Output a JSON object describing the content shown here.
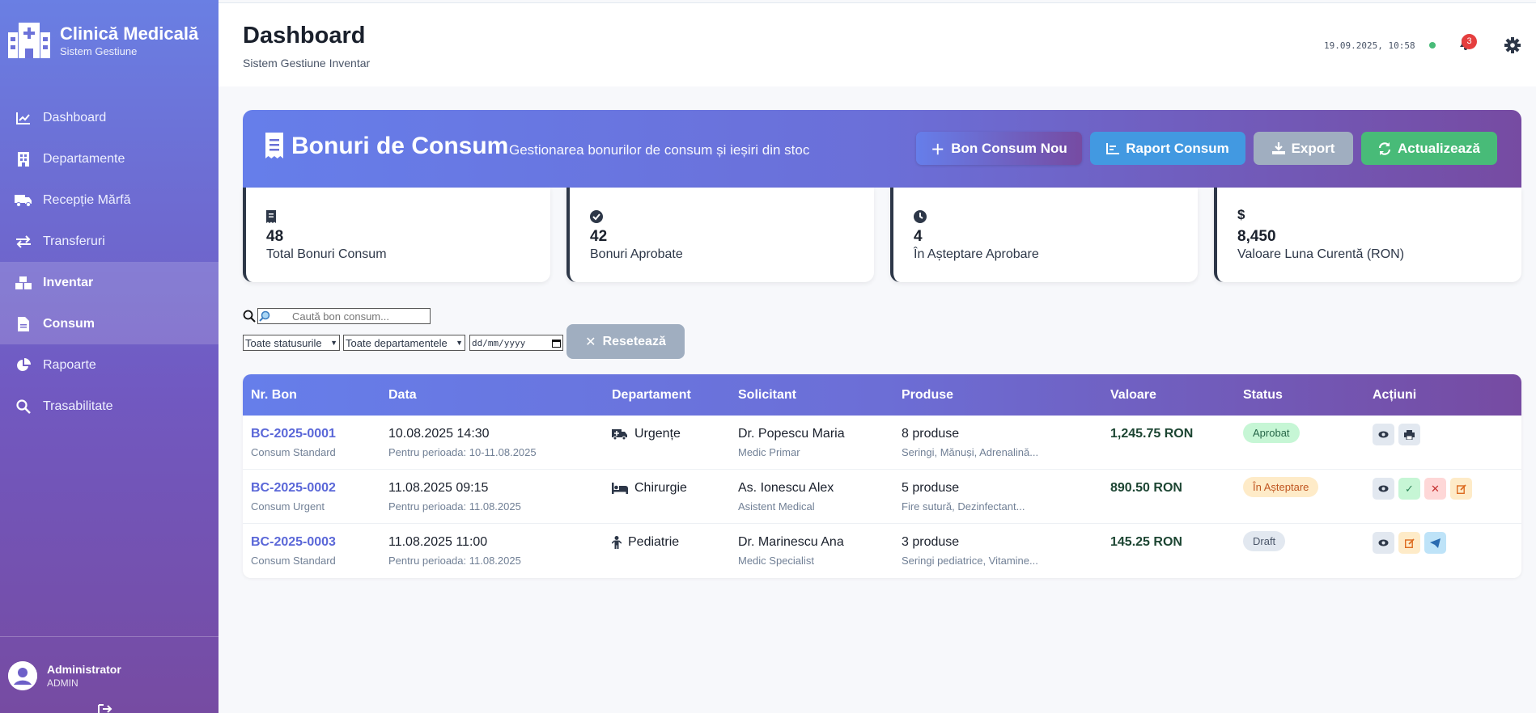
{
  "sidebar": {
    "brand_title": "Clinică Medicală",
    "brand_sub": "Sistem Gestiune",
    "items": [
      {
        "label": "Dashboard",
        "icon": "chart-line-icon"
      },
      {
        "label": "Departamente",
        "icon": "building-icon"
      },
      {
        "label": "Recepție Mărfă",
        "icon": "truck-icon"
      },
      {
        "label": "Transferuri",
        "icon": "exchange-icon"
      },
      {
        "label": "Inventar",
        "icon": "boxes-icon"
      },
      {
        "label": "Consum",
        "icon": "file-icon"
      },
      {
        "label": "Rapoarte",
        "icon": "pie-chart-icon"
      },
      {
        "label": "Trasabilitate",
        "icon": "search-icon"
      }
    ],
    "user_name": "Administrator",
    "user_role": "ADMIN"
  },
  "header": {
    "title": "Dashboard",
    "subtitle": "Sistem Gestiune Inventar",
    "datetime": "19.09.2025, 10:58",
    "notifications": "3"
  },
  "banner": {
    "title": "Bonuri de Consum",
    "subtitle": "Gestionarea bonurilor de consum și ieșiri din stoc",
    "btn_new": "Bon Consum Nou",
    "btn_report": "Raport Consum",
    "btn_export": "Export",
    "btn_refresh": "Actualizează"
  },
  "stats": [
    {
      "value": "48",
      "label": "Total Bonuri Consum",
      "icon": "receipt-icon"
    },
    {
      "value": "42",
      "label": "Bonuri Aprobate",
      "icon": "check-circle-icon"
    },
    {
      "value": "4",
      "label": "În Așteptare Aprobare",
      "icon": "clock-icon"
    },
    {
      "value": "8,450",
      "label": "Valoare Luna Curentă (RON)",
      "icon": "dollar-icon"
    }
  ],
  "filters": {
    "search_placeholder": "Caută bon consum...",
    "status": "Toate statusurile",
    "department": "Toate departamentele",
    "date_placeholder": "dd/mm/yyyy",
    "reset": "Resetează"
  },
  "table": {
    "headers": [
      "Nr. Bon",
      "Data",
      "Departament",
      "Solicitant",
      "Produse",
      "Valoare",
      "Status",
      "Acțiuni"
    ],
    "rows": [
      {
        "nr": "BC-2025-0001",
        "type": "Consum Standard",
        "date": "10.08.2025 14:30",
        "period": "Pentru perioada: 10-11.08.2025",
        "dept": "Urgențe",
        "dept_icon": "ambulance-icon",
        "requester": "Dr. Popescu Maria",
        "role": "Medic Primar",
        "products": "8 produse",
        "products_detail": "Seringi, Mănuși, Adrenalină...",
        "value": "1,245.75 RON",
        "status": "Aprobat",
        "status_kind": "ok",
        "actions": [
          "view",
          "print"
        ]
      },
      {
        "nr": "BC-2025-0002",
        "type": "Consum Urgent",
        "date": "11.08.2025 09:15",
        "period": "Pentru perioada: 11.08.2025",
        "dept": "Chirurgie",
        "dept_icon": "bed-icon",
        "requester": "As. Ionescu Alex",
        "role": "Asistent Medical",
        "products": "5 produse",
        "products_detail": "Fire sutură, Dezinfectant...",
        "value": "890.50 RON",
        "status": "În Așteptare",
        "status_kind": "wait",
        "actions": [
          "view",
          "approve",
          "reject",
          "edit"
        ]
      },
      {
        "nr": "BC-2025-0003",
        "type": "Consum Standard",
        "date": "11.08.2025 11:00",
        "period": "Pentru perioada: 11.08.2025",
        "dept": "Pediatrie",
        "dept_icon": "child-icon",
        "requester": "Dr. Marinescu Ana",
        "role": "Medic Specialist",
        "products": "3 produse",
        "products_detail": "Seringi pediatrice, Vitamine...",
        "value": "145.25 RON",
        "status": "Draft",
        "status_kind": "draft",
        "actions": [
          "view",
          "edit",
          "send"
        ]
      }
    ]
  }
}
